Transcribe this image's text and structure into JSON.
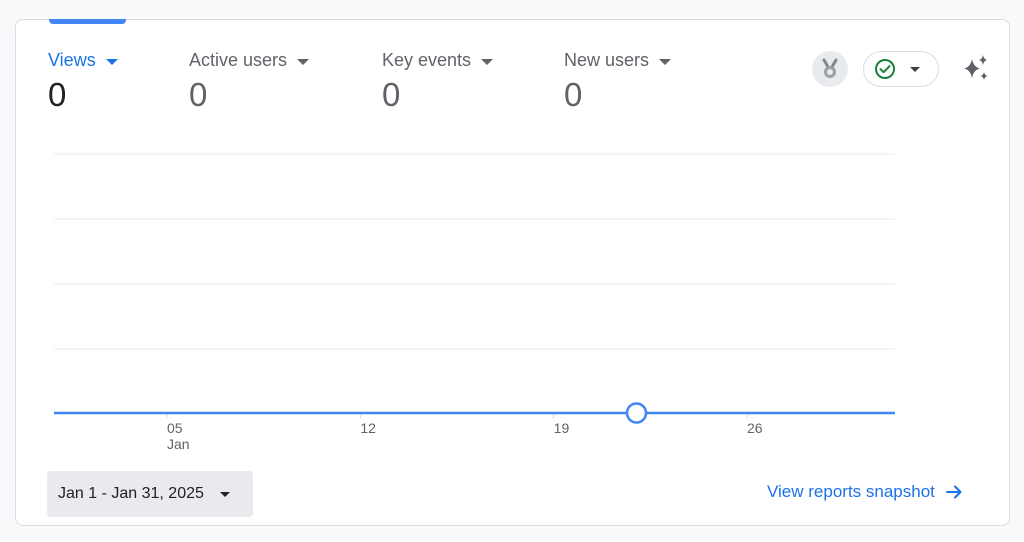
{
  "metrics": [
    {
      "label": "Views",
      "value": "0",
      "active": true
    },
    {
      "label": "Active users",
      "value": "0",
      "active": false
    },
    {
      "label": "Key events",
      "value": "0",
      "active": false
    },
    {
      "label": "New users",
      "value": "0",
      "active": false
    }
  ],
  "toolbar": {
    "badge_icon": "medal-icon",
    "status_icon": "check-circle-icon",
    "insights_icon": "sparkle-icon"
  },
  "chart_data": {
    "type": "line",
    "x_tick_labels": [
      {
        "day": "05",
        "month": "Jan"
      },
      {
        "day": "12",
        "month": ""
      },
      {
        "day": "19",
        "month": ""
      },
      {
        "day": "26",
        "month": ""
      }
    ],
    "x": [
      "Jan 1",
      "Jan 2",
      "Jan 3",
      "Jan 4",
      "Jan 5",
      "Jan 6",
      "Jan 7",
      "Jan 8",
      "Jan 9",
      "Jan 10",
      "Jan 11",
      "Jan 12",
      "Jan 13",
      "Jan 14",
      "Jan 15",
      "Jan 16",
      "Jan 17",
      "Jan 18",
      "Jan 19",
      "Jan 20",
      "Jan 21",
      "Jan 22",
      "Jan 23",
      "Jan 24",
      "Jan 25",
      "Jan 26",
      "Jan 27",
      "Jan 28",
      "Jan 29",
      "Jan 30",
      "Jan 31"
    ],
    "series": [
      {
        "values": [
          0,
          0,
          0,
          0,
          0,
          0,
          0,
          0,
          0,
          0,
          0,
          0,
          0,
          0,
          0,
          0,
          0,
          0,
          0,
          0,
          0,
          0,
          0,
          0,
          0,
          0,
          0,
          0,
          0,
          0,
          0
        ]
      }
    ],
    "highlighted_point": "Jan 22",
    "gridlines": true,
    "color": "#4285f4"
  },
  "footer": {
    "date_range": "Jan 1 - Jan 31, 2025",
    "snapshot_link": "View reports snapshot"
  }
}
